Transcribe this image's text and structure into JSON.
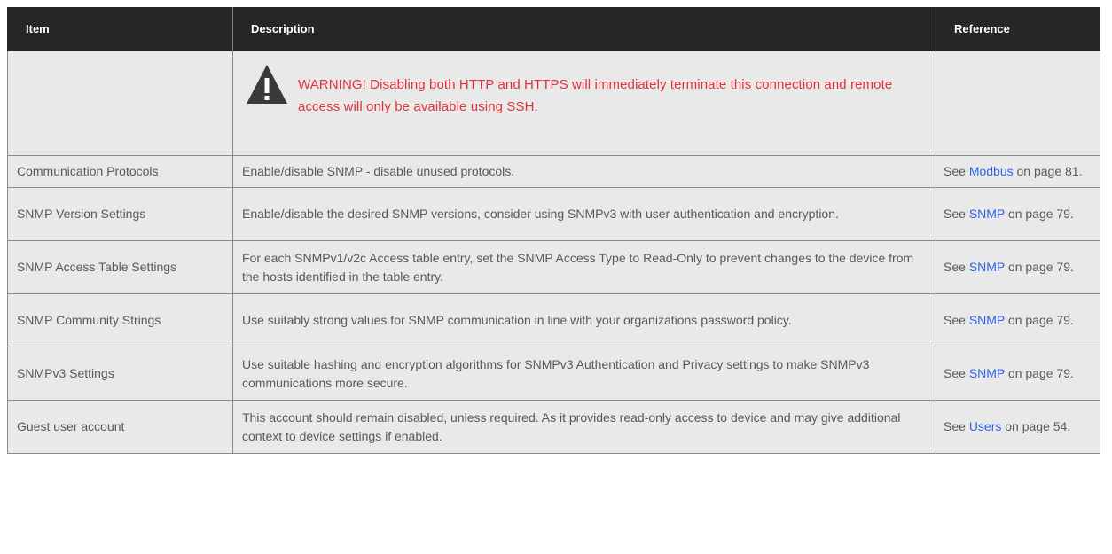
{
  "header": {
    "item": "Item",
    "description": "Description",
    "reference": "Reference"
  },
  "warning": {
    "icon": "warning-triangle-icon",
    "text": "WARNING! Disabling both HTTP and HTTPS will immediately terminate this connection and remote access will only be available using SSH.",
    "color": "#e1323c"
  },
  "rows": [
    {
      "item": "Communication Protocols",
      "description": "Enable/disable SNMP - disable unused protocols.",
      "ref_prefix": "See ",
      "ref_link": "Modbus",
      "ref_suffix": " on page 81."
    },
    {
      "item": "SNMP Version Settings",
      "description": "Enable/disable the desired SNMP versions, consider using SNMPv3 with user authentication and encryption.",
      "ref_prefix": "See ",
      "ref_link": "SNMP",
      "ref_suffix": " on page 79."
    },
    {
      "item": "SNMP Access Table Settings",
      "description": "For each SNMPv1/v2c Access table entry, set the SNMP Access Type to Read-Only to prevent changes to the device from the hosts identified in the table entry.",
      "ref_prefix": "See ",
      "ref_link": "SNMP",
      "ref_suffix": " on page 79."
    },
    {
      "item": "SNMP Community Strings",
      "description": "Use suitably strong values for SNMP communication in line with your organizations password policy.",
      "ref_prefix": "See ",
      "ref_link": "SNMP",
      "ref_suffix": " on page 79."
    },
    {
      "item": "SNMPv3 Settings",
      "description": "Use suitable hashing and encryption algorithms for SNMPv3 Authentication and Privacy settings to make SNMPv3 communications more secure.",
      "ref_prefix": "See ",
      "ref_link": "SNMP",
      "ref_suffix": " on page 79."
    },
    {
      "item": "Guest user account",
      "description": "This account should remain disabled, unless required. As it provides read-only access to device and may give additional context to device settings if enabled.",
      "ref_prefix": "See ",
      "ref_link": "Users",
      "ref_suffix": " on page 54."
    }
  ],
  "colors": {
    "header_bg": "#262626",
    "row_bg": "#e9e9e9",
    "link": "#2b64e8"
  }
}
